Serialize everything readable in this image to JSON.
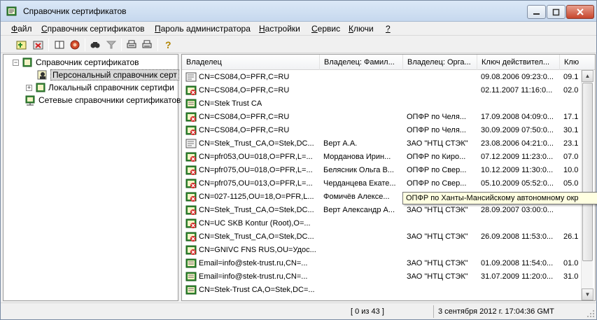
{
  "window": {
    "title": "Справочник сертификатов"
  },
  "menu": [
    {
      "label": "Файл",
      "key": "Ф",
      "rest": "айл"
    },
    {
      "label": "Справочник сертификатов",
      "key": "С",
      "rest": "правочник сертификатов"
    },
    {
      "label": "Пароль администратора",
      "key": "П",
      "rest": "ароль администратора"
    },
    {
      "label": "Настройки",
      "key": "Н",
      "rest": "астройки"
    },
    {
      "label": "Сервис",
      "key": "С",
      "rest": "ервис"
    },
    {
      "label": "Ключи",
      "key": "К",
      "rest": "лючи"
    },
    {
      "label": "?",
      "key": "?",
      "rest": ""
    }
  ],
  "toolbar": {
    "icons": [
      "add-certificate-icon",
      "delete-certificate-icon",
      "book-icon",
      "settings-seal-icon",
      "find-icon",
      "filter-icon",
      "print-icon",
      "print-list-icon",
      "help-icon"
    ]
  },
  "tree": {
    "root": "Справочник сертификатов",
    "personal": "Персональный справочник серт",
    "local": "Локальный справочник сертифи",
    "network": "Сетевые справочники сертификатов"
  },
  "list": {
    "columns": [
      "Владелец",
      "Владелец: Фамил...",
      "Владелец: Орга...",
      "Ключ действител...",
      "Клю"
    ],
    "rows": [
      {
        "icon": "plain",
        "owner": "CN=CS084,O=PFR,C=RU",
        "surname": "",
        "org": "",
        "valid": "09.08.2006 09:23:0...",
        "extra": "09.1"
      },
      {
        "icon": "revoked",
        "owner": "CN=CS084,O=PFR,C=RU",
        "surname": "",
        "org": "",
        "valid": "02.11.2007 11:16:0...",
        "extra": "02.0"
      },
      {
        "icon": "valid",
        "owner": "CN=Stek Trust CA",
        "surname": "",
        "org": "",
        "valid": "",
        "extra": ""
      },
      {
        "icon": "revoked",
        "owner": "CN=CS084,O=PFR,C=RU",
        "surname": "",
        "org": "ОПФР по Челя...",
        "valid": "17.09.2008 04:09:0...",
        "extra": "17.1"
      },
      {
        "icon": "revoked",
        "owner": "CN=CS084,O=PFR,C=RU",
        "surname": "",
        "org": "ОПФР по Челя...",
        "valid": "30.09.2009 07:50:0...",
        "extra": "30.1"
      },
      {
        "icon": "plain",
        "owner": "CN=Stek_Trust_CA,O=Stek,DC...",
        "surname": "Верт А.А.",
        "org": "ЗАО \"НТЦ СТЭК\"",
        "valid": "23.08.2006 04:21:0...",
        "extra": "23.1"
      },
      {
        "icon": "revoked",
        "owner": "CN=pfr053,OU=018,O=PFR,L=...",
        "surname": "Морданова Ирин...",
        "org": "ОПФР по Киро...",
        "valid": "07.12.2009 11:23:0...",
        "extra": "07.0"
      },
      {
        "icon": "revoked",
        "owner": "CN=pfr075,OU=018,O=PFR,L=...",
        "surname": "Белясник Ольга В...",
        "org": "ОПФР по Свер...",
        "valid": "10.12.2009 11:30:0...",
        "extra": "10.0"
      },
      {
        "icon": "revoked",
        "owner": "CN=pfr075,OU=013,O=PFR,L=...",
        "surname": "Черданцева Екате...",
        "org": "ОПФР по Свер...",
        "valid": "05.10.2009 05:52:0...",
        "extra": "05.0"
      },
      {
        "icon": "revoked",
        "owner": "CN=027-1125,OU=18,O=PFR,L...",
        "surname": "Фомичёв Алексе...",
        "org": "",
        "valid": "",
        "extra": ""
      },
      {
        "icon": "revoked",
        "owner": "CN=Stek_Trust_CA,O=Stek,DC...",
        "surname": "Верт Александр А...",
        "org": "ЗАО \"НТЦ СТЭК\"",
        "valid": "28.09.2007 03:00:0...",
        "extra": ""
      },
      {
        "icon": "revoked",
        "owner": "CN=UC SKB Kontur (Root),O=...",
        "surname": "",
        "org": "",
        "valid": "",
        "extra": ""
      },
      {
        "icon": "revoked",
        "owner": "CN=Stek_Trust_CA,O=Stek,DC...",
        "surname": "",
        "org": "ЗАО \"НТЦ СТЭК\"",
        "valid": "26.09.2008 11:53:0...",
        "extra": "26.1"
      },
      {
        "icon": "revoked",
        "owner": "CN=GNIVC FNS RUS,OU=Удос...",
        "surname": "",
        "org": "",
        "valid": "",
        "extra": ""
      },
      {
        "icon": "valid",
        "owner": "Email=info@stek-trust.ru,CN=...",
        "surname": "",
        "org": "ЗАО \"НТЦ СТЭК\"",
        "valid": "01.09.2008 11:54:0...",
        "extra": "01.0"
      },
      {
        "icon": "valid",
        "owner": "Email=info@stek-trust.ru,CN=...",
        "surname": "",
        "org": "ЗАО \"НТЦ СТЭК\"",
        "valid": "31.07.2009 11:20:0...",
        "extra": "31.0"
      },
      {
        "icon": "valid",
        "owner": "CN=Stek-Trust CA,O=Stek,DC=...",
        "surname": "",
        "org": "",
        "valid": "",
        "extra": ""
      }
    ]
  },
  "tooltip": "ОПФР по Ханты-Мансийскому автономному окр",
  "status": {
    "count": "[ 0 из 43 ]",
    "datetime": "3 сентября 2012 г. 17:04:36 GMT"
  },
  "colors": {
    "title_bg": "#c6d8ee",
    "tooltip_bg": "#ffffe1",
    "revoked_red": "#d21f1f",
    "cert_green": "#2f8a2f"
  }
}
